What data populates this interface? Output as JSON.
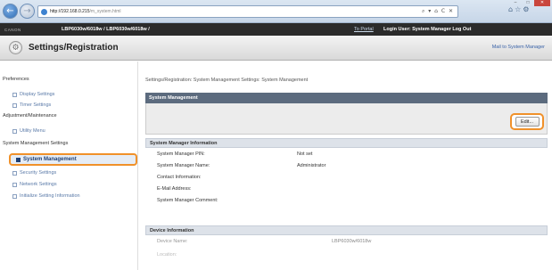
{
  "browser": {
    "url_host": "http://192.168.0.215",
    "url_path": "/m_system.html",
    "address_tools": "⌕ ▾ ⌂ C ✕",
    "window_controls": [
      "–",
      "□",
      "✕"
    ]
  },
  "header": {
    "brand": "CANON",
    "device_title": "LBP6030w/6018w / LBP6030w/6018w /",
    "to_portal": "To Portal",
    "login_user": "Login User: System Manager  Log Out"
  },
  "titlebar": {
    "title": "Settings/Registration",
    "mail": "Mail to System Manager"
  },
  "sidebar": {
    "groups": [
      {
        "label": "Preferences",
        "items": [
          "Display Settings",
          "Timer Settings"
        ]
      },
      {
        "label": "Adjustment/Maintenance",
        "items": [
          "Utility Menu"
        ]
      },
      {
        "label": "System Management Settings",
        "items": [
          "System Management",
          "Security Settings",
          "Network Settings",
          "Initialize Setting Information"
        ]
      }
    ],
    "selected": "System Management"
  },
  "main": {
    "breadcrumb": "Settings/Registration: System Management Settings: System Management",
    "panel_title": "System Management",
    "edit_label": "Edit...",
    "sections": [
      {
        "title": "System Manager Information",
        "rows": [
          {
            "label": "System Manager PIN:",
            "value": "Not set"
          },
          {
            "label": "System Manager Name:",
            "value": "Administrator"
          },
          {
            "label": "Contact Information:",
            "value": ""
          },
          {
            "label": "E-Mail Address:",
            "value": ""
          },
          {
            "label": "System Manager Comment:",
            "value": ""
          }
        ]
      },
      {
        "title": "Device Information",
        "rows": [
          {
            "label": "Device Name:",
            "value": "LBP6030w/6018w"
          },
          {
            "label": "Location:",
            "value": ""
          }
        ]
      }
    ]
  }
}
